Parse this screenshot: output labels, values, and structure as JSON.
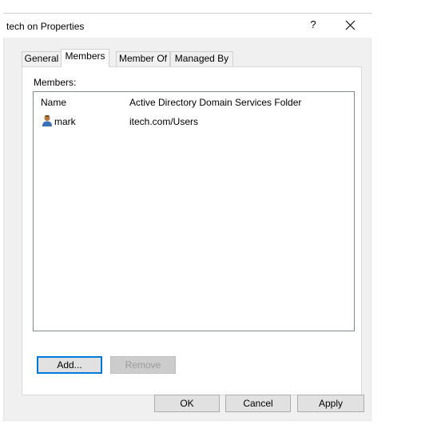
{
  "window": {
    "title": "tech on Properties",
    "help_label": "?"
  },
  "tabs": [
    {
      "label": "General",
      "active": false
    },
    {
      "label": "Members",
      "active": true
    },
    {
      "label": "Member Of",
      "active": false
    },
    {
      "label": "Managed By",
      "active": false
    }
  ],
  "members": {
    "label": "Members:",
    "columns": [
      "Name",
      "Active Directory Domain Services Folder"
    ],
    "rows": [
      {
        "name": "mark",
        "folder": "itech.com/Users",
        "icon": "user-icon"
      }
    ],
    "add_label": "Add...",
    "remove_label": "Remove"
  },
  "footer": {
    "ok_label": "OK",
    "cancel_label": "Cancel",
    "apply_label": "Apply"
  }
}
